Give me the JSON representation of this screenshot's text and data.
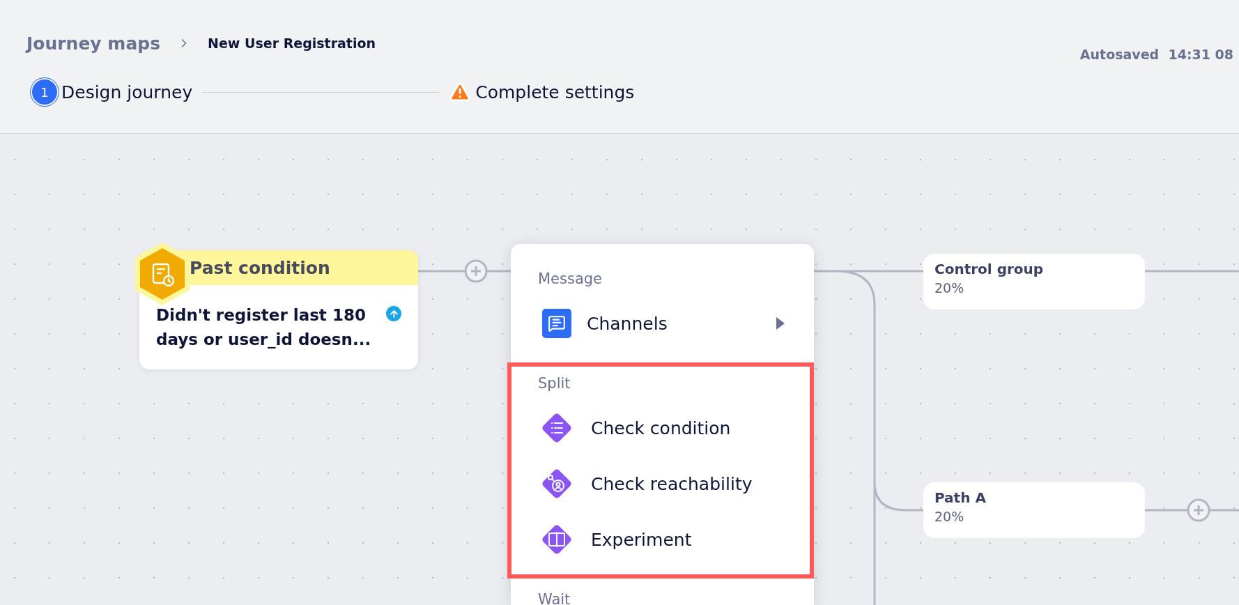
{
  "breadcrumb": [
    {
      "label": "Journey maps",
      "kind": "link"
    },
    {
      "label": "New User Registration",
      "kind": "current"
    }
  ],
  "autosave": {
    "label": "Autosaved",
    "time": "14:31 08"
  },
  "steps": [
    {
      "number": "1",
      "label": "Design journey",
      "kind": "current"
    },
    {
      "label": "Complete settings",
      "kind": "warning"
    }
  ],
  "canvas": {
    "condition_node": {
      "title": "Past condition",
      "description": "Didn't register last 180 days or user_id doesn..."
    },
    "branches": [
      {
        "name": "Control group",
        "share": "20%"
      },
      {
        "name": "Path A",
        "share": "20%"
      }
    ],
    "menu": {
      "sections": [
        {
          "title": "Message",
          "highlighted": false,
          "items": [
            {
              "label": "Channels",
              "kind": "channels",
              "submenu": true
            }
          ]
        },
        {
          "title": "Split",
          "highlighted": true,
          "items": [
            {
              "label": "Check condition",
              "kind": "condition",
              "submenu": false
            },
            {
              "label": "Check reachability",
              "kind": "reachability",
              "submenu": false
            },
            {
              "label": "Experiment",
              "kind": "experiment",
              "submenu": false
            }
          ]
        },
        {
          "title": "Wait",
          "highlighted": false
        }
      ]
    }
  }
}
